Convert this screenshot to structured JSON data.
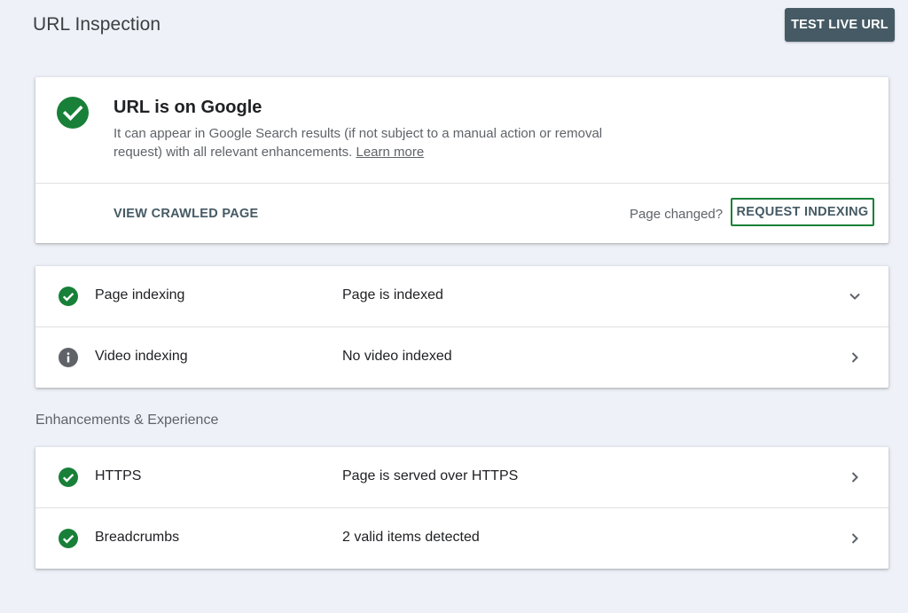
{
  "header": {
    "title": "URL Inspection",
    "test_live_label": "TEST LIVE URL"
  },
  "status": {
    "icon": "check-circle-icon",
    "title": "URL is on Google",
    "description": "It can appear in Google Search results (if not subject to a manual action or removal request) with all relevant enhancements.",
    "learn_more": "Learn more",
    "view_crawled_label": "VIEW CRAWLED PAGE",
    "page_changed_label": "Page changed?",
    "request_indexing_label": "REQUEST INDEXING"
  },
  "indexing": {
    "rows": [
      {
        "icon": "check-circle-icon",
        "label": "Page indexing",
        "value": "Page is indexed",
        "chevron": "chevron-down-icon"
      },
      {
        "icon": "info-icon",
        "label": "Video indexing",
        "value": "No video indexed",
        "chevron": "chevron-right-icon"
      }
    ]
  },
  "enhancements": {
    "section_label": "Enhancements & Experience",
    "rows": [
      {
        "icon": "check-circle-icon",
        "label": "HTTPS",
        "value": "Page is served over HTTPS",
        "chevron": "chevron-right-icon"
      },
      {
        "icon": "check-circle-icon",
        "label": "Breadcrumbs",
        "value": "2 valid items detected",
        "chevron": "chevron-right-icon"
      }
    ]
  },
  "colors": {
    "success_green": "#188038",
    "button_slate": "#455a64",
    "info_grey": "#5f6368",
    "background": "#eef1f7"
  }
}
